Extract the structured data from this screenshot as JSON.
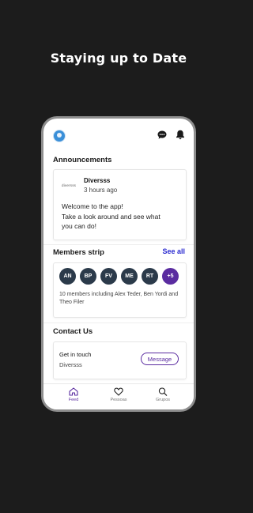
{
  "hero": {
    "title": "Staying up to Date"
  },
  "announcements": {
    "heading": "Announcements",
    "card": {
      "logo_text": "diversss",
      "author": "Diversss",
      "time": "3 hours ago",
      "lines": [
        "Welcome to the app!",
        "Take a look around and see what",
        "you can do!"
      ]
    }
  },
  "members": {
    "heading": "Members strip",
    "see_all": "See all",
    "chips": [
      "AN",
      "BP",
      "FV",
      "ME",
      "RT",
      "+5"
    ],
    "description": "10 members including Alex Teder, Ben Yordi and Theo Filer"
  },
  "contact": {
    "heading": "Contact Us",
    "title": "Get in touch",
    "subtitle": "Diversss",
    "button": "Message"
  },
  "tabbar": {
    "tabs": [
      {
        "label": "Feed",
        "icon": "home-icon",
        "active": true
      },
      {
        "label": "Pessoas",
        "icon": "heart-icon",
        "active": false
      },
      {
        "label": "Grupos",
        "icon": "search-icon",
        "active": false
      }
    ]
  },
  "colors": {
    "accent": "#5a2ca0",
    "link": "#2a2ad0",
    "chip": "#2b3a4a",
    "background": "#1c1c1c"
  }
}
